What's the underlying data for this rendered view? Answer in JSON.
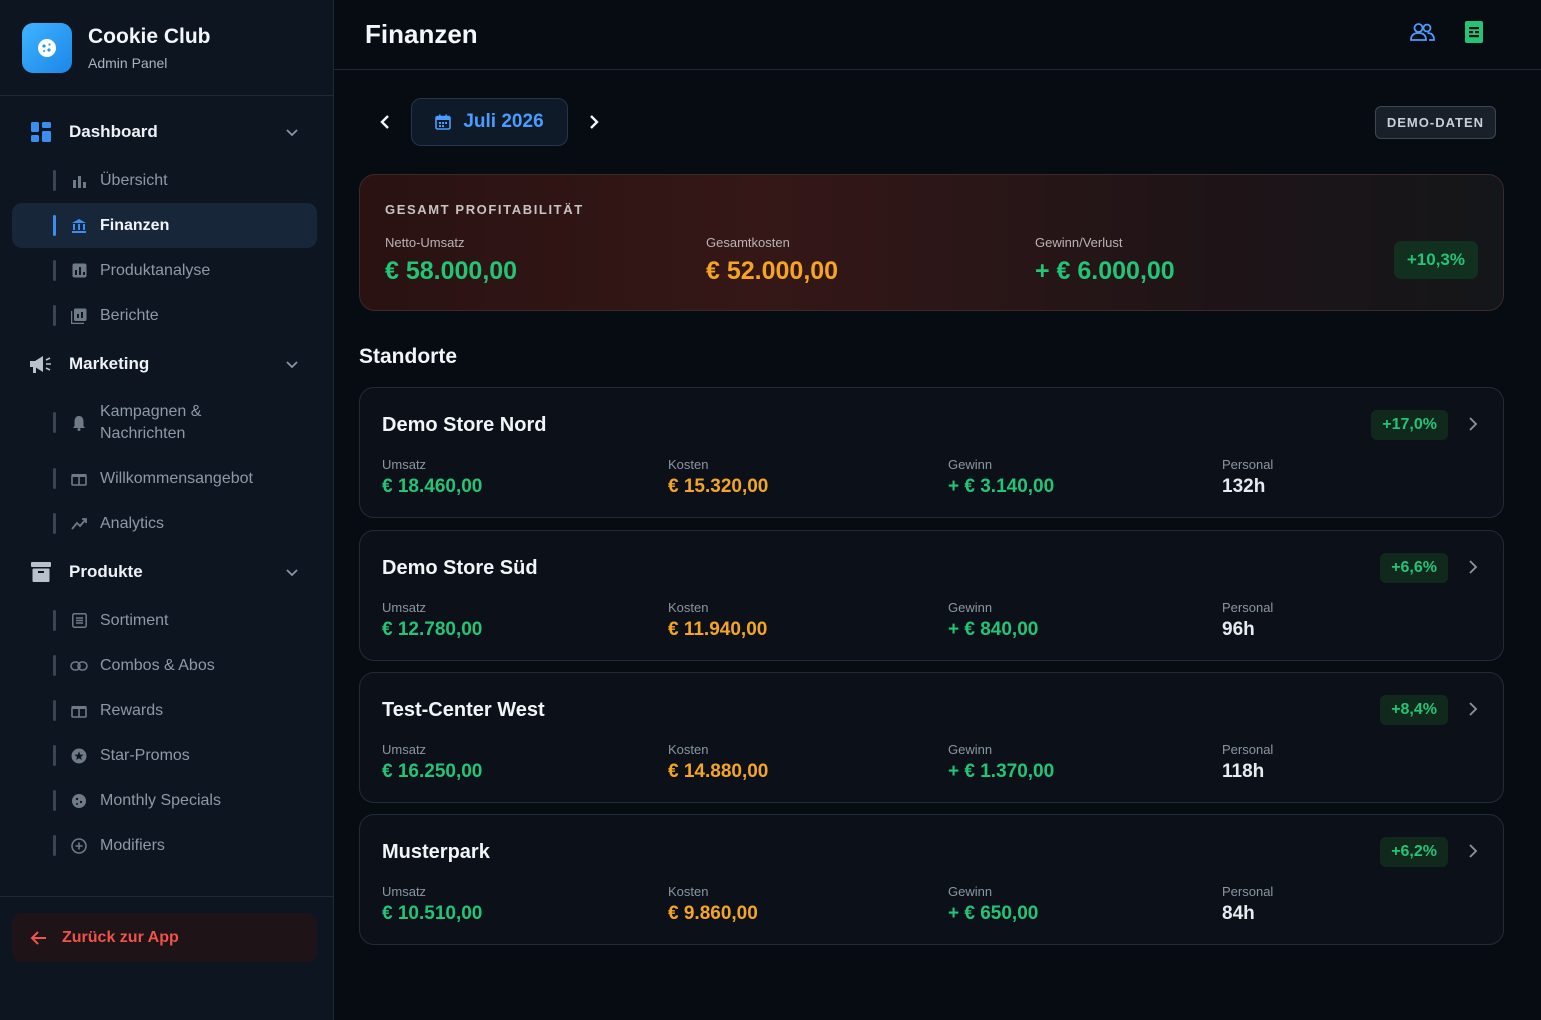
{
  "brand": {
    "title": "Cookie Club",
    "subtitle": "Admin Panel",
    "icon": "cookie-icon"
  },
  "sidebar": {
    "sections": [
      {
        "label": "Dashboard",
        "icon": "dashboard-grid-icon",
        "items": [
          {
            "label": "Übersicht",
            "icon": "bar-chart-icon"
          },
          {
            "label": "Finanzen",
            "icon": "bank-icon",
            "active": true
          },
          {
            "label": "Produktanalyse",
            "icon": "analysis-icon"
          },
          {
            "label": "Berichte",
            "icon": "reports-icon"
          }
        ]
      },
      {
        "label": "Marketing",
        "icon": "megaphone-icon",
        "items": [
          {
            "label": "Kampagnen & Nachrichten",
            "line1": "Kampagnen &",
            "line2": "Nachrichten",
            "icon": "bell-icon"
          },
          {
            "label": "Willkommensangebot",
            "icon": "gift-icon"
          },
          {
            "label": "Analytics",
            "icon": "trend-icon"
          }
        ]
      },
      {
        "label": "Produkte",
        "icon": "archive-box-icon",
        "items": [
          {
            "label": "Sortiment",
            "icon": "list-icon"
          },
          {
            "label": "Combos & Abos",
            "icon": "link-icon"
          },
          {
            "label": "Rewards",
            "icon": "gift-icon"
          },
          {
            "label": "Star-Promos",
            "icon": "star-icon"
          },
          {
            "label": "Monthly Specials",
            "icon": "cookie-icon"
          },
          {
            "label": "Modifiers",
            "icon": "plus-circle-icon"
          }
        ]
      }
    ],
    "back_label": "Zurück zur App"
  },
  "header": {
    "title": "Finanzen",
    "icons": [
      "users-icon",
      "spreadsheet-icon"
    ]
  },
  "period": {
    "label": "Juli 2026",
    "demo_badge": "DEMO-DATEN"
  },
  "profitability": {
    "heading": "GESAMT PROFITABILITÄT",
    "revenue_label": "Netto-Umsatz",
    "revenue": "€ 58.000,00",
    "costs_label": "Gesamtkosten",
    "costs": "€ 52.000,00",
    "profit_label": "Gewinn/Verlust",
    "profit": "+ € 6.000,00",
    "margin": "+10,3%"
  },
  "locations_title": "Standorte",
  "metric_labels": {
    "revenue": "Umsatz",
    "costs": "Kosten",
    "profit": "Gewinn",
    "staff": "Personal"
  },
  "stores": [
    {
      "name": "Demo Store Nord",
      "margin": "+17,0%",
      "revenue": "€ 18.460,00",
      "costs": "€ 15.320,00",
      "profit": "+ € 3.140,00",
      "staff": "132h"
    },
    {
      "name": "Demo Store Süd",
      "margin": "+6,6%",
      "revenue": "€ 12.780,00",
      "costs": "€ 11.940,00",
      "profit": "+ € 840,00",
      "staff": "96h"
    },
    {
      "name": "Test-Center West",
      "margin": "+8,4%",
      "revenue": "€ 16.250,00",
      "costs": "€ 14.880,00",
      "profit": "+ € 1.370,00",
      "staff": "118h"
    },
    {
      "name": "Musterpark",
      "margin": "+6,2%",
      "revenue": "€ 10.510,00",
      "costs": "€ 9.860,00",
      "profit": "+ € 650,00",
      "staff": "84h"
    }
  ],
  "colors": {
    "accent": "#3b8ef0",
    "positive": "#22c476",
    "cost": "#f5a524",
    "danger": "#f0534a"
  }
}
